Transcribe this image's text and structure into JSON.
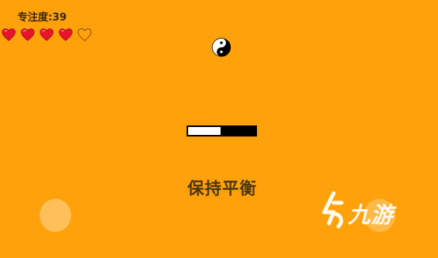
{
  "hud": {
    "focus_label": "专注度:39",
    "lives_total": 5,
    "lives_remaining": 4,
    "heart_color": "#E8142B"
  },
  "game": {
    "balance_level": 0.48,
    "instruction": "保持平衡",
    "background_color": "#FFA10A"
  },
  "watermark": {
    "text": "九游"
  },
  "icons": {
    "center": "yin-yang-icon",
    "life": "heart-icon",
    "watermark": "jiuyou-logo-icon"
  }
}
